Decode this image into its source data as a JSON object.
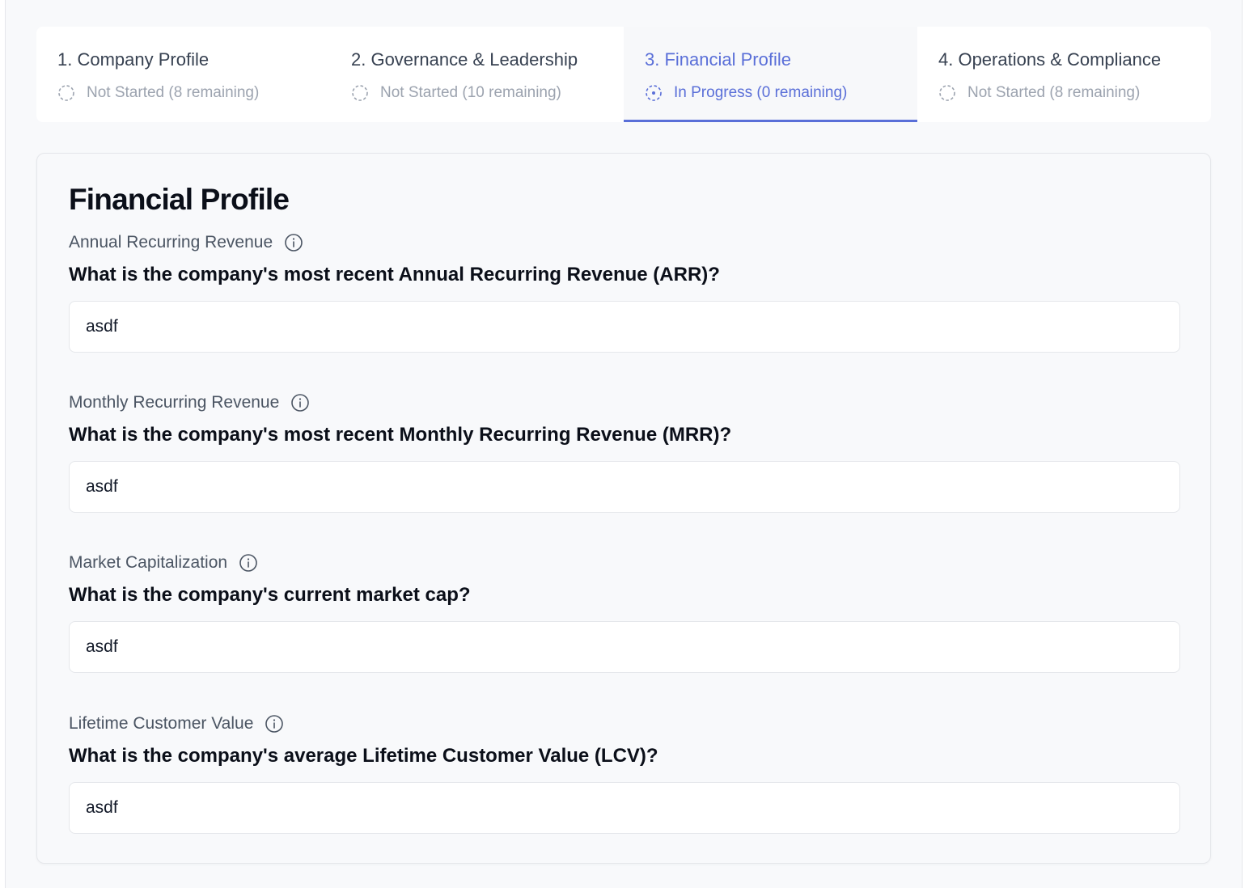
{
  "stepper": {
    "steps": [
      {
        "title": "1. Company Profile",
        "status": "Not Started (8 remaining)",
        "icon": "dashed-circle-icon",
        "active": false
      },
      {
        "title": "2. Governance & Leadership",
        "status": "Not Started (10 remaining)",
        "icon": "dashed-circle-icon",
        "active": false
      },
      {
        "title": "3. Financial Profile",
        "status": "In Progress (0 remaining)",
        "icon": "dashed-circle-dot-icon",
        "active": true
      },
      {
        "title": "4. Operations & Compliance",
        "status": "Not Started (8 remaining)",
        "icon": "dashed-circle-icon",
        "active": false
      }
    ]
  },
  "form": {
    "title": "Financial Profile",
    "fields": [
      {
        "label": "Annual Recurring Revenue",
        "question": "What is the company's most recent Annual Recurring Revenue (ARR)?",
        "value": "asdf",
        "icon": "info-icon"
      },
      {
        "label": "Monthly Recurring Revenue",
        "question": "What is the company's most recent Monthly Recurring Revenue (MRR)?",
        "value": "asdf",
        "icon": "info-icon"
      },
      {
        "label": "Market Capitalization",
        "question": "What is the company's current market cap?",
        "value": "asdf",
        "icon": "info-icon"
      },
      {
        "label": "Lifetime Customer Value",
        "question": "What is the company's average Lifetime Customer Value (LCV)?",
        "value": "asdf",
        "icon": "info-icon"
      }
    ]
  },
  "colors": {
    "accent": "#5a6fd8",
    "muted": "#9ca3af"
  }
}
